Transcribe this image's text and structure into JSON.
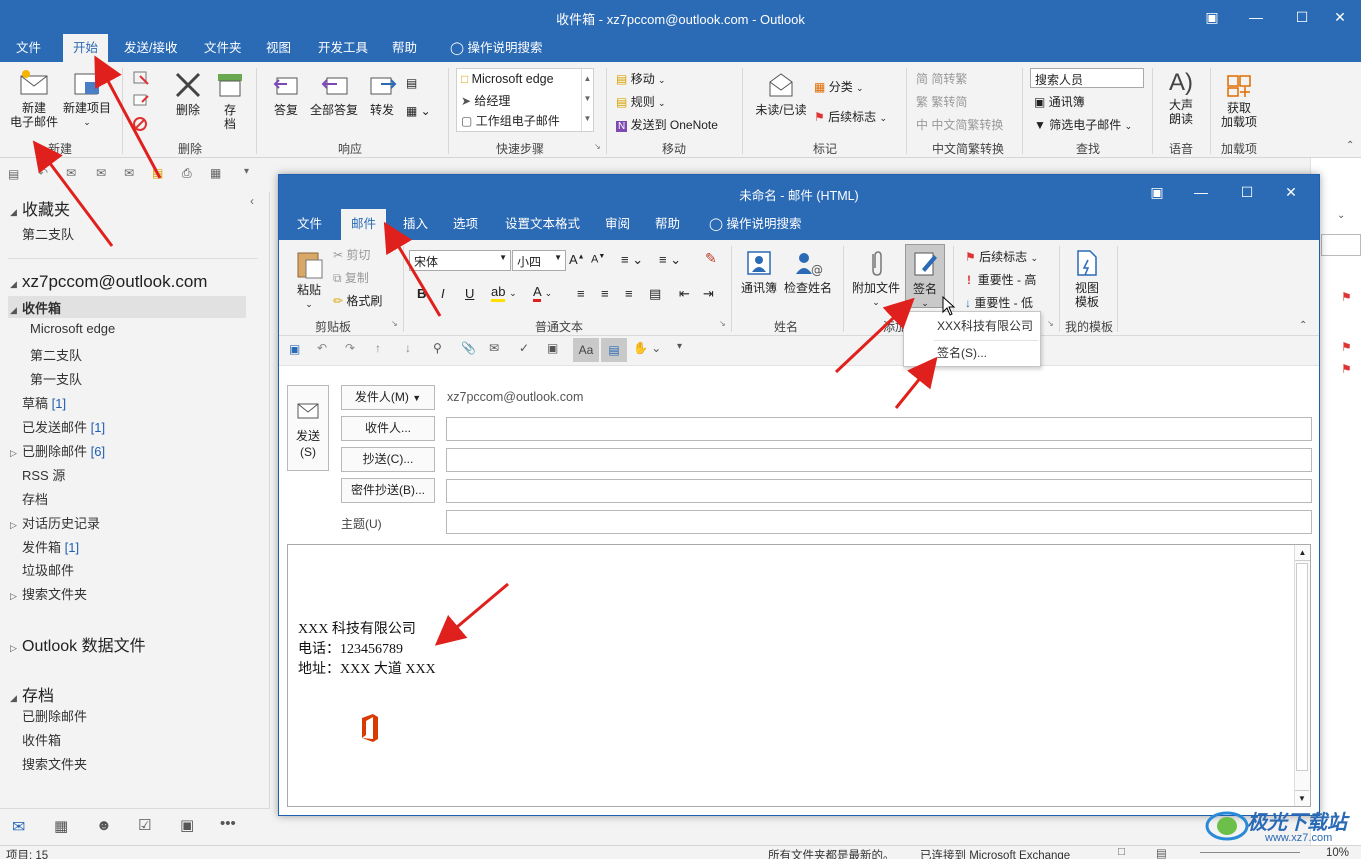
{
  "main_window": {
    "title": "收件箱 - xz7pccom@outlook.com  -  Outlook",
    "tabs": [
      "文件",
      "开始",
      "发送/接收",
      "文件夹",
      "视图",
      "开发工具",
      "帮助",
      "操作说明搜索"
    ],
    "ribbon": {
      "new_email": "新建\n电子邮件",
      "new_email_l1": "新建",
      "new_email_l2": "电子邮件",
      "new_item": "新建项目",
      "group_new": "新建",
      "delete": "删除",
      "archive_l1": "存",
      "archive_l2": "档",
      "group_delete": "删除",
      "reply": "答复",
      "reply_all": "全部答复",
      "forward": "转发",
      "group_respond": "响应",
      "quick_steps": [
        "Microsoft edge",
        "给经理",
        "工作组电子邮件"
      ],
      "group_quicksteps": "快速步骤",
      "move": "移动",
      "rules": "规则",
      "onenote": "发送到 OneNote",
      "group_move": "移动",
      "unread_read": "未读/已读",
      "categorize": "分类",
      "followup": "后续标志",
      "group_tags": "标记",
      "to_traditional": "简转繁",
      "to_simplified": "繁转简",
      "convert": "中文简繁转换",
      "group_chinese": "中文简繁转换",
      "search_people": "搜索人员",
      "address_book": "通讯簿",
      "filter_email": "筛选电子邮件",
      "group_find": "查找",
      "read_aloud_l1": "大声",
      "read_aloud_l2": "朗读",
      "group_speech": "语音",
      "get_addins_l1": "获取",
      "get_addins_l2": "加载项",
      "group_addins": "加载项"
    }
  },
  "folders": {
    "favorites": "收藏夹",
    "fav_item": "第二支队",
    "account": "xz7pccom@outlook.com",
    "inbox": "收件箱",
    "sub1": "Microsoft edge",
    "sub2": "第二支队",
    "sub3": "第一支队",
    "drafts": "草稿",
    "drafts_count": "[1]",
    "sent": "已发送邮件",
    "sent_count": "[1]",
    "deleted": "已删除邮件",
    "deleted_count": "[6]",
    "rss": "RSS 源",
    "archive": "存档",
    "conv_history": "对话历史记录",
    "outbox": "发件箱",
    "outbox_count": "[1]",
    "junk": "垃圾邮件",
    "search_folders": "搜索文件夹",
    "data_file": "Outlook 数据文件",
    "archive_head": "存档",
    "a_deleted": "已删除邮件",
    "a_inbox": "收件箱",
    "a_search": "搜索文件夹"
  },
  "status": {
    "items": "项目: 15",
    "uptodate": "所有文件夹都是最新的。",
    "connected": "已连接到 Microsoft Exchange",
    "zoom": "10%"
  },
  "compose": {
    "title": "未命名  -  邮件 (HTML)",
    "tabs": [
      "文件",
      "邮件",
      "插入",
      "选项",
      "设置文本格式",
      "审阅",
      "帮助",
      "操作说明搜索"
    ],
    "ribbon": {
      "paste": "粘贴",
      "cut": "剪切",
      "copy": "复制",
      "format_painter": "格式刷",
      "group_clipboard": "剪贴板",
      "font_name": "宋体",
      "font_size": "小四",
      "group_basic_text": "普通文本",
      "address_book": "通讯簿",
      "check_names": "检查姓名",
      "group_names": "姓名",
      "attach": "附加文件",
      "signature": "签名",
      "group_include": "添加",
      "followup": "后续标志",
      "high": "重要性 - 高",
      "low": "重要性 - 低",
      "view_templates_l1": "视图",
      "view_templates_l2": "模板",
      "group_templates": "我的模板"
    },
    "from_btn": "发件人(M)",
    "from_value": "xz7pccom@outlook.com",
    "to_btn": "收件人...",
    "cc_btn": "抄送(C)...",
    "bcc_btn": "密件抄送(B)...",
    "subject_label": "主题(U)",
    "send_l1": "发送",
    "send_l2": "(S)",
    "to_value": "",
    "cc_value": "",
    "bcc_value": "",
    "subject_value": "",
    "signature_lines": [
      "XXX 科技有限公司",
      "电话：123456789",
      "地址：XXX 大道 XXX"
    ]
  },
  "signature_menu": {
    "item1": "XXX科技有限公司",
    "item2": "签名(S)..."
  },
  "watermark": {
    "text": "极光下载站",
    "url": "www.xz7.com"
  },
  "colors": {
    "brand": "#2b6ab5",
    "arrow": "#e0201c"
  }
}
